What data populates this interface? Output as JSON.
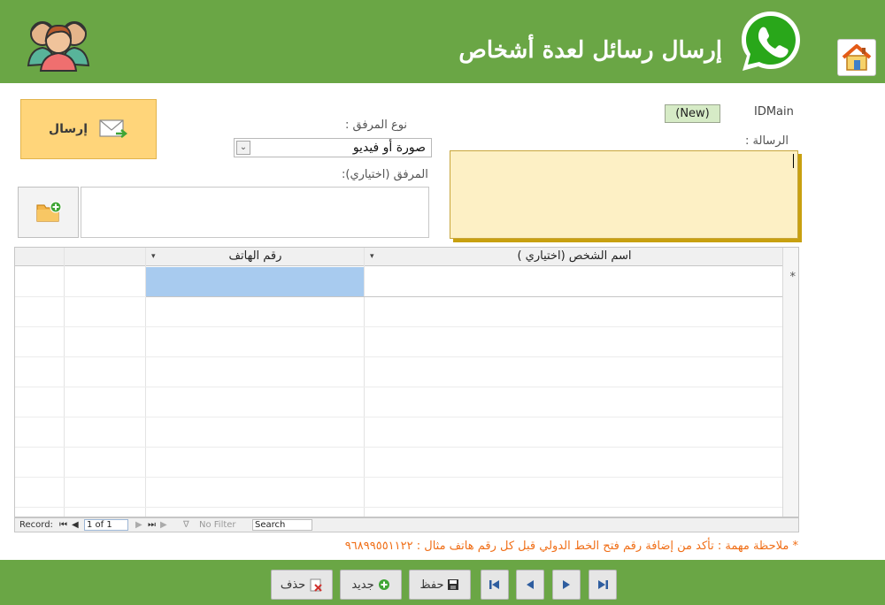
{
  "header": {
    "title": "إرسال رسائل لعدة أشخاص",
    "users_icon": "users-group-icon",
    "app_icon": "whatsapp-icon",
    "home_icon": "home-icon",
    "bar_color": "#6aa645"
  },
  "form": {
    "idmain_label": "IDMain",
    "idmain_value": "(New)",
    "message_label": "الرسالة :",
    "message_value": "",
    "attachment_type_label": "نوع المرفق :",
    "attachment_type_value": "صورة أو فيديو",
    "attachment_label": "المرفق (اختياري):",
    "attachment_value": "",
    "send_label": "إرسال",
    "send_icon": "envelope-arrow-icon",
    "browse_icon": "folder-add-icon",
    "send_color": "#ffd57a",
    "message_color": "#fdf0c5"
  },
  "grid": {
    "columns": [
      "اسم الشخص (اختياري )",
      "رقم الهاتف"
    ],
    "new_row_marker": "*",
    "selection_color": "#a8cbef"
  },
  "record_nav": {
    "record_label": "Record:",
    "position": "1 of 1",
    "filter_label": "No Filter",
    "search_placeholder": "Search"
  },
  "note": "* ملاحظة مهمة : تأكد من إضافة رقم فتح الخط الدولي قبل كل رقم هاتف مثال : ٩٦٨٩٩٥٥١١٢٢",
  "toolbar": {
    "delete_label": "حذف",
    "new_label": "جديد",
    "save_label": "حفظ",
    "delete_icon": "delete-icon",
    "new_icon": "add-icon",
    "save_icon": "save-icon",
    "nav_icons": [
      "first-record-icon",
      "previous-record-icon",
      "next-record-icon",
      "last-record-icon"
    ]
  }
}
